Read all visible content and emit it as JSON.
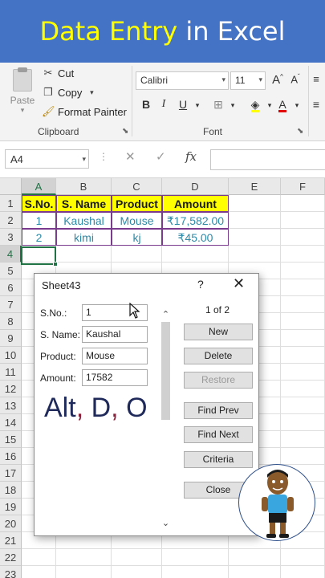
{
  "banner": {
    "part1": "Data Entry",
    "part2": "in Excel"
  },
  "ribbon": {
    "paste_label": "Paste",
    "cut": "Cut",
    "copy": "Copy",
    "format_painter": "Format Painter",
    "clipboard_group": "Clipboard",
    "font_name": "Calibri",
    "font_size": "11",
    "font_group": "Font",
    "bold": "B",
    "italic": "I",
    "underline": "U"
  },
  "formula_bar": {
    "name_box": "A4",
    "fx": "fx"
  },
  "grid": {
    "columns": [
      "A",
      "B",
      "C",
      "D",
      "E",
      "F"
    ],
    "rows": [
      "1",
      "2",
      "3",
      "4",
      "5",
      "6",
      "7",
      "8",
      "9",
      "10",
      "11",
      "12",
      "13",
      "14",
      "15",
      "16",
      "17",
      "18",
      "19",
      "20",
      "21",
      "22",
      "23"
    ],
    "headers": [
      "S.No.",
      "S. Name",
      "Product",
      "Amount"
    ],
    "data": [
      [
        "1",
        "Kaushal",
        "Mouse",
        "₹17,582.00"
      ],
      [
        "2",
        "kimi",
        "kj",
        "₹45.00"
      ]
    ]
  },
  "dialog": {
    "title": "Sheet43",
    "help": "?",
    "close": "✕",
    "fields": [
      {
        "label": "S.No.:",
        "value": "1"
      },
      {
        "label": "S. Name:",
        "value": "Kaushal"
      },
      {
        "label": "Product:",
        "value": "Mouse"
      },
      {
        "label": "Amount:",
        "value": "17582"
      }
    ],
    "record_count": "1 of 2",
    "buttons": {
      "new": "New",
      "delete": "Delete",
      "restore": "Restore",
      "find_prev": "Find Prev",
      "find_next": "Find Next",
      "criteria": "Criteria",
      "close": "Close"
    },
    "shortcut": {
      "alt": "Alt",
      "d": "D",
      "o": "O"
    }
  },
  "colors": {
    "accent": "#217346",
    "banner": "#4472c4",
    "header_fill": "#ffff00",
    "data_text": "#2b8aa8",
    "border": "#7a3b8f"
  }
}
